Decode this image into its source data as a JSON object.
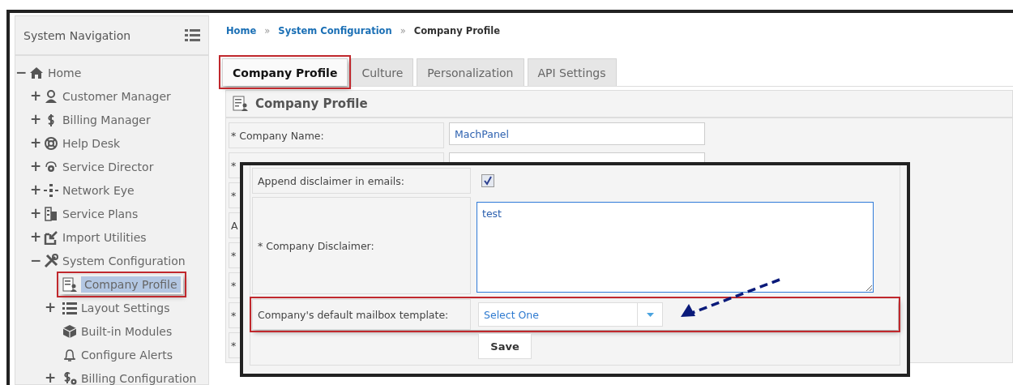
{
  "sidebar": {
    "title": "System Navigation",
    "tree": [
      {
        "label": "Home",
        "toggle": "−",
        "selected": false,
        "highlighted": false,
        "children": [
          {
            "label": "Customer Manager",
            "toggle": "+",
            "selected": false,
            "highlighted": false
          },
          {
            "label": "Billing Manager",
            "toggle": "+",
            "selected": false,
            "highlighted": false
          },
          {
            "label": "Help Desk",
            "toggle": "+",
            "selected": false,
            "highlighted": false
          },
          {
            "label": "Service Director",
            "toggle": "+",
            "selected": false,
            "highlighted": false
          },
          {
            "label": "Network Eye",
            "toggle": "+",
            "selected": false,
            "highlighted": false
          },
          {
            "label": "Service Plans",
            "toggle": "+",
            "selected": false,
            "highlighted": false
          },
          {
            "label": "Import Utilities",
            "toggle": "+",
            "selected": false,
            "highlighted": false
          },
          {
            "label": "System Configuration",
            "toggle": "−",
            "selected": false,
            "highlighted": false,
            "children": [
              {
                "label": "Company Profile",
                "selected": true,
                "highlighted": true
              },
              {
                "label": "Layout Settings",
                "toggle": "+",
                "selected": false,
                "highlighted": false
              },
              {
                "label": "Built-in Modules",
                "selected": false,
                "highlighted": false
              },
              {
                "label": "Configure Alerts",
                "selected": false,
                "highlighted": false
              },
              {
                "label": "Billing Configuration",
                "toggle": "+",
                "selected": false,
                "highlighted": false
              }
            ]
          }
        ]
      }
    ]
  },
  "breadcrumb": [
    {
      "label": "Home",
      "kind": "link"
    },
    {
      "label": "»",
      "kind": "separator"
    },
    {
      "label": "System Configuration",
      "kind": "link"
    },
    {
      "label": "»",
      "kind": "separator"
    },
    {
      "label": "Company Profile",
      "kind": "current"
    }
  ],
  "tabs": [
    {
      "label": "Company Profile",
      "selected": true,
      "highlighted": true
    },
    {
      "label": "Culture",
      "selected": false,
      "highlighted": false
    },
    {
      "label": "Personalization",
      "selected": false,
      "highlighted": false
    },
    {
      "label": "API Settings",
      "selected": false,
      "highlighted": false
    }
  ],
  "panel": {
    "title": "Company Profile",
    "rows": [
      {
        "label": "* Company Name:",
        "value": "MachPanel"
      },
      {
        "label": "*",
        "value": ""
      },
      {
        "label": "*"
      },
      {
        "label": "A"
      },
      {
        "label": "*"
      },
      {
        "label": "*"
      },
      {
        "label": "*"
      },
      {
        "label": "*"
      }
    ]
  },
  "callout": {
    "rows": [
      {
        "kind": "checkbox",
        "label": "Append disclaimer in emails:",
        "checked": true,
        "highlighted": false
      },
      {
        "kind": "textarea",
        "label": "* Company Disclaimer:",
        "value": "test",
        "highlighted": false
      },
      {
        "kind": "select",
        "label": "Company's default mailbox template:",
        "value": "Select One",
        "highlighted": true
      }
    ],
    "button": "Save",
    "arrow": true
  }
}
